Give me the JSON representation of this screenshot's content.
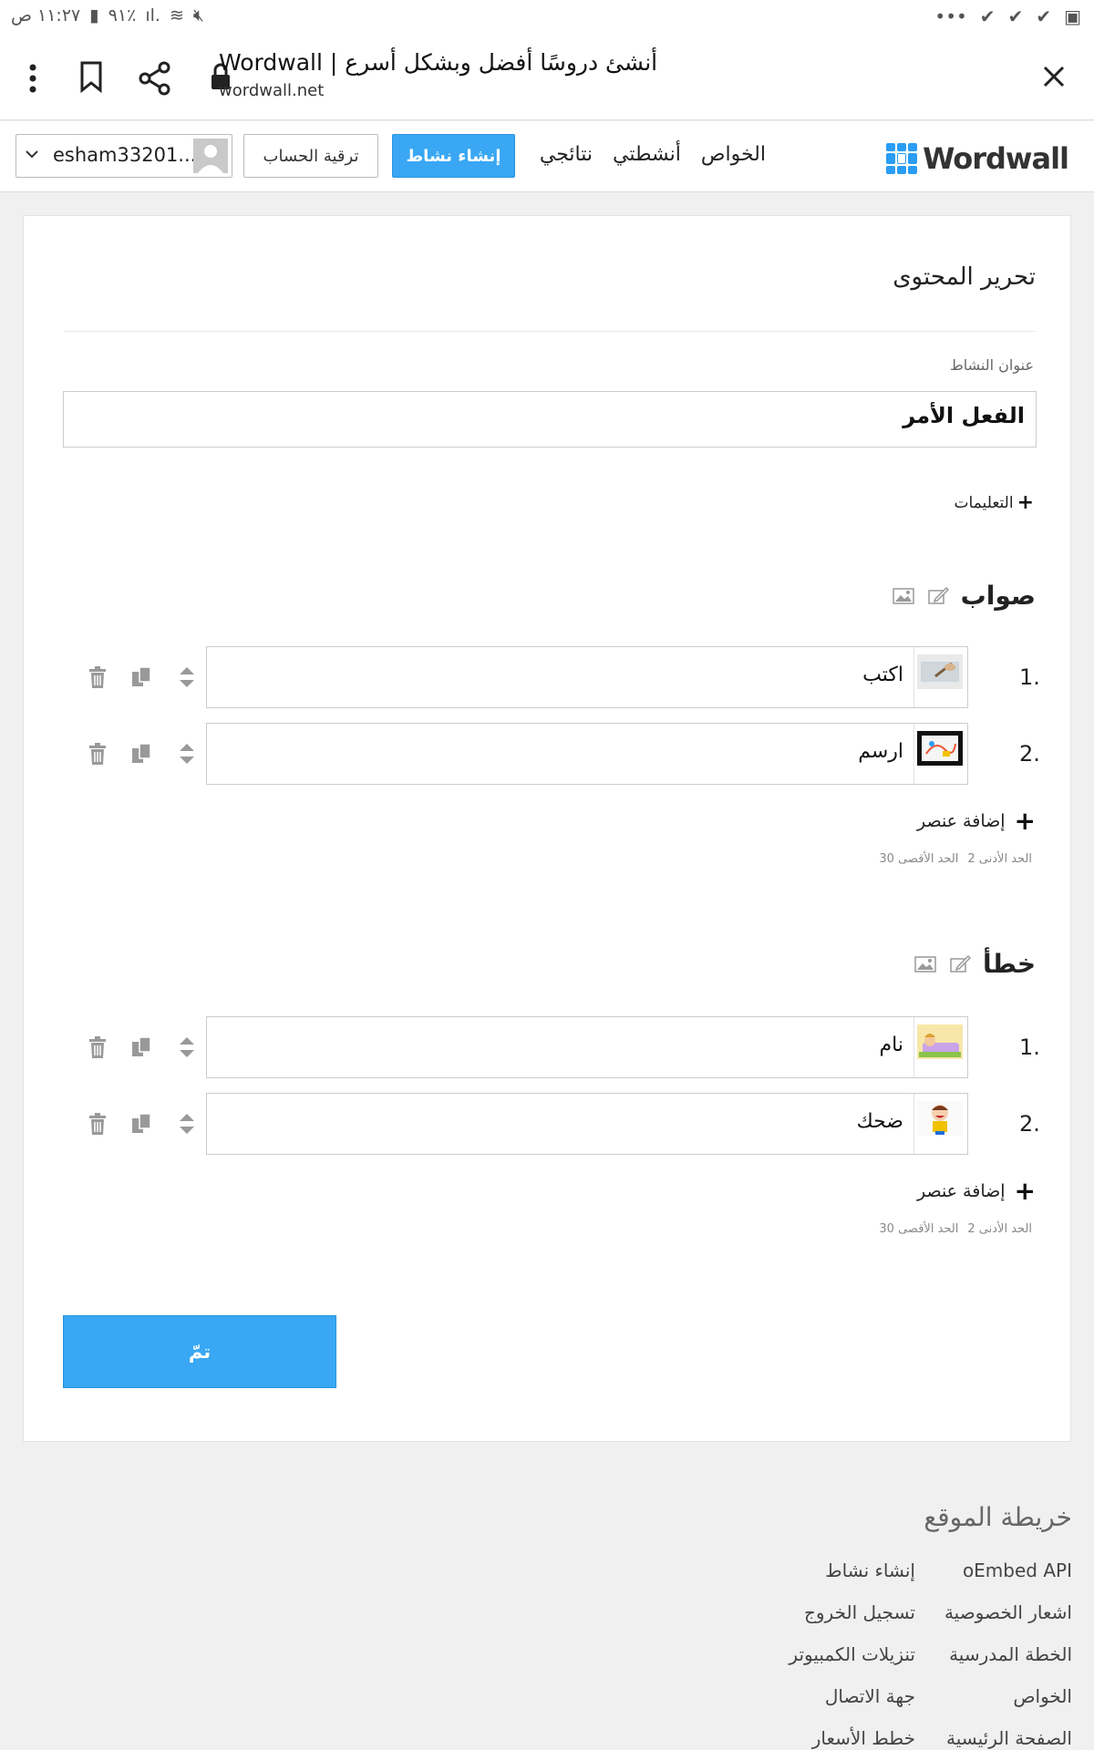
{
  "status": {
    "time": "١١:٢٧ ص",
    "battery": "٩١٪"
  },
  "browser": {
    "title": "Wordwall | أنشئ دروسًا أفضل وبشكل أسرع",
    "url": "wordwall.net"
  },
  "header": {
    "logo_text": "Wordwall",
    "nav": [
      "الخواص",
      "أنشطتي",
      "نتائجي"
    ],
    "create_label": "إنشاء نشاط",
    "upgrade_label": "ترقية الحساب",
    "username": "esham33201..."
  },
  "editor": {
    "heading": "تحرير المحتوى",
    "title_label": "عنوان النشاط",
    "title_value": "الفعل الأمر",
    "instructions_label": "التعليمات",
    "groups": [
      {
        "title": "صواب",
        "items": [
          {
            "num": "1.",
            "text": "اكتب",
            "thumb": "writing-image"
          },
          {
            "num": "2.",
            "text": "ارسم",
            "thumb": "drawing-image"
          }
        ],
        "add_label": "إضافة عنصر",
        "min_label": "الحد الأدنى",
        "min_value": "2",
        "max_label": "الحد الأقصى",
        "max_value": "30"
      },
      {
        "title": "خطأ",
        "items": [
          {
            "num": "1.",
            "text": "نام",
            "thumb": "sleeping-image"
          },
          {
            "num": "2.",
            "text": "ضحك",
            "thumb": "laughing-image"
          }
        ],
        "add_label": "إضافة عنصر",
        "min_label": "الحد الأدنى",
        "min_value": "2",
        "max_label": "الحد الأقصى",
        "max_value": "30"
      }
    ],
    "done_label": "تمّ"
  },
  "sitemap": {
    "title": "خريطة الموقع",
    "col_right": [
      "oEmbed API",
      "اشعار الخصوصية",
      "الخطة المدرسية",
      "الخواص",
      "الصفحة الرئيسية"
    ],
    "col_left": [
      "إنشاء نشاط",
      "تسجيل الخروج",
      "تنزيلات الكمبيوتر",
      "جهة الاتصال",
      "خطط الأسعار"
    ]
  },
  "colors": {
    "accent": "#39a7f3",
    "logo_blue": "#2a9df4"
  }
}
